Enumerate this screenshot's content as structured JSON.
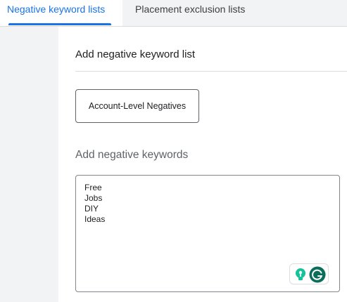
{
  "tabs": {
    "active_label": "Negative keyword lists",
    "inactive_label": "Placement exclusion lists"
  },
  "panel": {
    "title": "Add negative keyword list",
    "list_name": "Account-Level Negatives",
    "keywords_label": "Add negative keywords",
    "keywords": [
      "Free",
      "Jobs",
      "DIY",
      "Ideas"
    ]
  },
  "colors": {
    "accent": "#1a73e8",
    "extension_green": "#15c39a",
    "extension_dark": "#0b6e5a"
  },
  "icons": {
    "hint": "lightbulb-icon",
    "assistant": "grammarly-icon"
  }
}
